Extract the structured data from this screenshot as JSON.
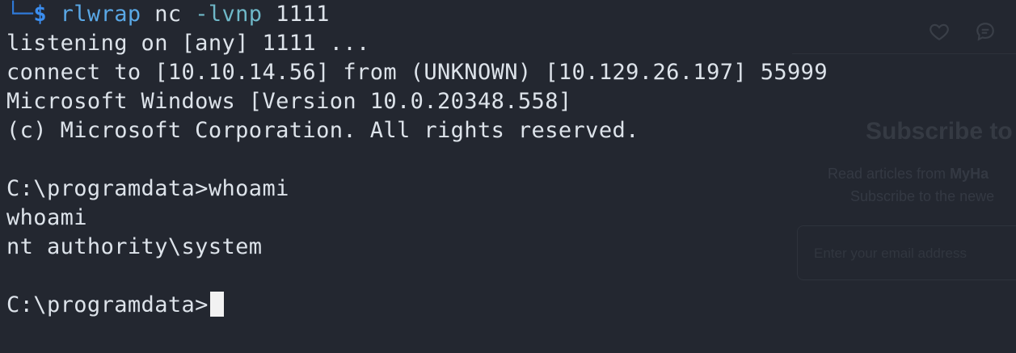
{
  "terminal": {
    "prompt_corner": "└─",
    "prompt_symbol": "$",
    "command": {
      "name": "rlwrap",
      "arg1": "nc",
      "flag": "-lvnp",
      "arg2": "1111"
    },
    "lines": [
      "listening on [any] 1111 ...",
      "connect to [10.10.14.56] from (UNKNOWN) [10.129.26.197] 55999",
      "Microsoft Windows [Version 10.0.20348.558]",
      "(c) Microsoft Corporation. All rights reserved.",
      "",
      "C:\\programdata>whoami",
      "whoami",
      "nt authority\\system",
      ""
    ],
    "current_prompt": "C:\\programdata>"
  },
  "overlay": {
    "heart_icon": "heart-icon",
    "comment_icon": "comment-icon",
    "title": "Subscribe to",
    "desc_line1_prefix": "Read articles from ",
    "desc_line1_bold": "MyHa",
    "desc_line2": "Subscribe to the newe",
    "email_placeholder": "Enter your email address"
  }
}
